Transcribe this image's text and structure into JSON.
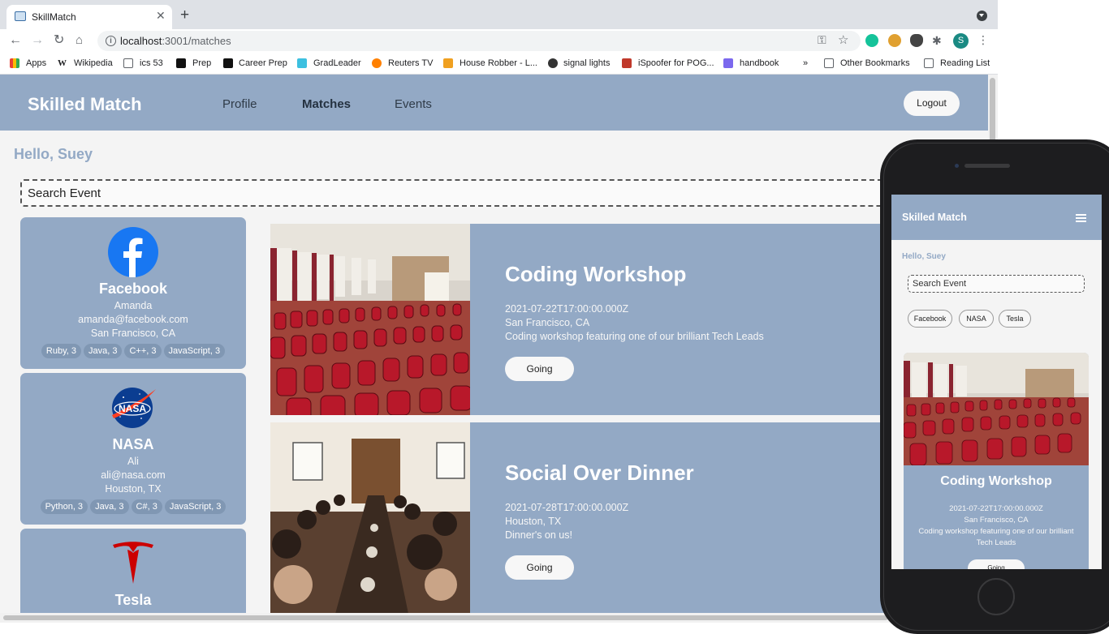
{
  "browser": {
    "tab_title": "SkillMatch",
    "new_tab": "+",
    "url_host": "localhost",
    "url_rest": ":3001/matches",
    "profile_initial": "S",
    "bookmarks": [
      "Apps",
      "Wikipedia",
      "ics 53",
      "Prep",
      "Career Prep",
      "GradLeader",
      "Reuters TV",
      "House Robber - L...",
      "signal lights",
      "iSpoofer for POG...",
      "handbook",
      "»",
      "Other Bookmarks",
      "Reading List"
    ]
  },
  "app": {
    "brand": "Skilled Match",
    "nav": [
      "Profile",
      "Matches",
      "Events"
    ],
    "logout": "Logout",
    "greeting": "Hello, Suey",
    "search_placeholder": "Search Event"
  },
  "companies": [
    {
      "name": "Facebook",
      "contact": "Amanda",
      "email": "amanda@facebook.com",
      "location": "San Francisco, CA",
      "skills": [
        "Ruby, 3",
        "Java, 3",
        "C++, 3",
        "JavaScript, 3"
      ]
    },
    {
      "name": "NASA",
      "contact": "Ali",
      "email": "ali@nasa.com",
      "location": "Houston, TX",
      "skills": [
        "Python, 3",
        "Java, 3",
        "C#, 3",
        "JavaScript, 3"
      ]
    },
    {
      "name": "Tesla"
    }
  ],
  "events": [
    {
      "title": "Coding Workshop",
      "date": "2021-07-22T17:00:00.000Z",
      "location": "San Francisco, CA",
      "description": "Coding workshop featuring one of our brilliant Tech Leads",
      "button": "Going"
    },
    {
      "title": "Social Over Dinner",
      "date": "2021-07-28T17:00:00.000Z",
      "location": "Houston, TX",
      "description": "Dinner's on us!",
      "button": "Going"
    }
  ],
  "mobile": {
    "brand": "Skilled Match",
    "greeting": "Hello, Suey",
    "search_placeholder": "Search Event",
    "chips": [
      "Facebook",
      "NASA",
      "Tesla"
    ],
    "event": {
      "title": "Coding Workshop",
      "date": "2021-07-22T17:00:00.000Z",
      "location": "San Francisco, CA",
      "description": "Coding workshop featuring one of our brilliant Tech Leads",
      "button": "Going"
    }
  },
  "colors": {
    "primary": "#93a9c5",
    "chip": "#8097b3",
    "facebook": "#1877f2",
    "nasa": "#0b3d91",
    "tesla": "#cc0000"
  }
}
